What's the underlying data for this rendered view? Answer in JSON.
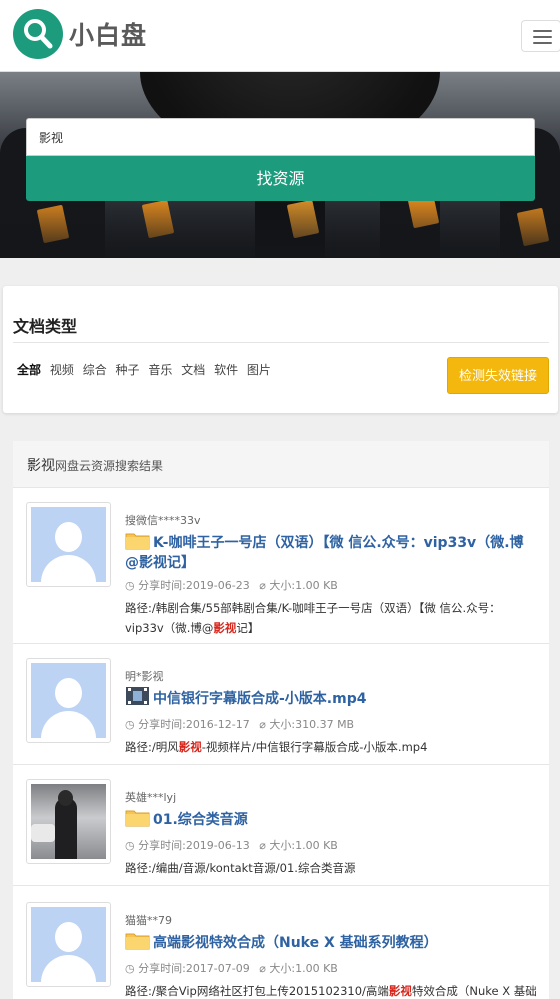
{
  "header": {
    "logo_text": "小白盘",
    "menu_icon": "hamburger-icon",
    "brand_color": "#1c9c7d"
  },
  "search": {
    "value": "影视",
    "button_label": "找资源"
  },
  "filter": {
    "title": "文档类型",
    "types": [
      "全部",
      "视频",
      "综合",
      "种子",
      "音乐",
      "文档",
      "软件",
      "图片"
    ],
    "active_type": "全部",
    "check_button_label": "检测失效链接"
  },
  "results": {
    "keyword": "影视",
    "header_suffix": "网盘云资源搜索结果",
    "items": [
      {
        "sharer": "搜微信****33v",
        "file_icon": "folder-icon",
        "title": "K-咖啡王子一号店（双语）【微 信公.众号：vip33v（微.博@影视记】",
        "share_time": "分享时间:2019-06-23",
        "size": "大小:1.00 KB",
        "path_before": "路径:/韩剧合集/55部韩剧合集/K-咖啡王子一号店（双语）【微 信公.众号：vip33v（微.博@",
        "path_hl": "影视",
        "path_after": "记】"
      },
      {
        "sharer": "明*影视",
        "file_icon": "video-file-icon",
        "title": "中信银行字幕版合成-小版本.mp4",
        "share_time": "分享时间:2016-12-17",
        "size": "大小:310.37 MB",
        "path_before": "路径:/明风",
        "path_hl": "影视",
        "path_after": "-视频样片/中信银行字幕版合成-小版本.mp4"
      },
      {
        "sharer": "英雄***lyj",
        "file_icon": "folder-icon",
        "title": "01.综合类音源",
        "share_time": "分享时间:2019-06-13",
        "size": "大小:1.00 KB",
        "path_before": "路径:/编曲/音源/kontakt音源/01.综合类音源",
        "path_hl": "",
        "path_after": ""
      },
      {
        "sharer": "猫猫**79",
        "file_icon": "folder-icon",
        "title": "高端影视特效合成（Nuke X 基础系列教程）",
        "share_time": "分享时间:2017-07-09",
        "size": "大小:1.00 KB",
        "path_before": "路径:/聚合Vip网络社区打包上传2015102310/高端",
        "path_hl": "影视",
        "path_after": "特效合成（Nuke X 基础系列教程）"
      }
    ]
  }
}
